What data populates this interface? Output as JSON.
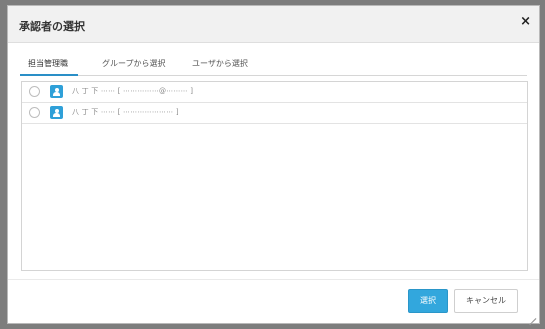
{
  "dialog": {
    "title": "承認者の選択",
    "close_icon": "×"
  },
  "tabs": [
    {
      "label": "担当管理職",
      "active": true
    },
    {
      "label": "グループから選択",
      "active": false
    },
    {
      "label": "ユーザから選択",
      "active": false
    }
  ],
  "list": {
    "items": [
      {
        "text": "八 丁 下 ⋯⋯ [ ⋯⋯⋯⋯⋯@⋯⋯⋯ ]",
        "icon": "user-icon"
      },
      {
        "text": "八 丁 下 ⋯⋯ [ ⋯⋯⋯⋯⋯⋯⋯ ]",
        "icon": "user-icon"
      }
    ]
  },
  "footer": {
    "select_label": "選択",
    "cancel_label": "キャンセル"
  },
  "colors": {
    "accent": "#32a7dd",
    "header_bg": "#f1f1f1",
    "backdrop": "#7d7d7d"
  }
}
